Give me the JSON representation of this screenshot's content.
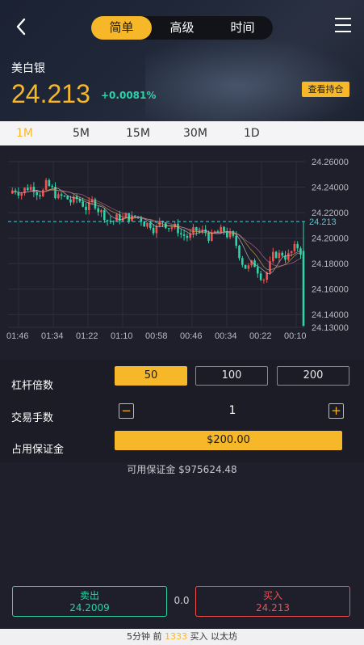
{
  "header": {
    "tabs": [
      {
        "label": "简单",
        "active": true
      },
      {
        "label": "高级",
        "active": false
      },
      {
        "label": "时间",
        "active": false
      }
    ],
    "asset_name": "美白银",
    "price": "24.213",
    "change": "+0.0081%",
    "hold_button": "查看持仓"
  },
  "timeframes": [
    {
      "label": "1M",
      "active": true
    },
    {
      "label": "5M",
      "active": false
    },
    {
      "label": "15M",
      "active": false
    },
    {
      "label": "30M",
      "active": false
    },
    {
      "label": "1D",
      "active": false
    }
  ],
  "chart_data": {
    "type": "candlestick",
    "y_ticks": [
      "24.26000",
      "24.24000",
      "24.22000",
      "24.20000",
      "24.18000",
      "24.16000",
      "24.14000",
      "24.13000"
    ],
    "x_ticks": [
      "01:46",
      "01:34",
      "01:22",
      "01:10",
      "00:58",
      "00:46",
      "00:34",
      "00:22",
      "00:10"
    ],
    "current_price_label": "24.213",
    "current_price": 24.213,
    "ylim": [
      24.13,
      24.26
    ],
    "grid": true,
    "colors": {
      "up": "#f0524f",
      "down": "#2dd4a8",
      "current_line": "#3fd0e0"
    }
  },
  "controls": {
    "leverage_label": "杠杆倍数",
    "leverage_options": [
      {
        "label": "50",
        "active": true
      },
      {
        "label": "100",
        "active": false
      },
      {
        "label": "200",
        "active": false
      }
    ],
    "lots_label": "交易手数",
    "minus": "−",
    "plus": "+",
    "quantity": "1",
    "margin_label": "占用保证金",
    "margin_value": "$200.00",
    "available_margin": "可用保证金 $975624.48"
  },
  "trade": {
    "sell_label": "卖出",
    "sell_price": "24.2009",
    "spread": "0.0",
    "buy_label": "买入",
    "buy_price": "24.213"
  },
  "footer": {
    "prefix": "5分钟 前",
    "count": "1333",
    "suffix": "买入 以太坊"
  },
  "colors": {
    "accent": "#f6b828",
    "up": "#f0524f",
    "down": "#2dd4a8",
    "background": "#1e1f2a"
  }
}
